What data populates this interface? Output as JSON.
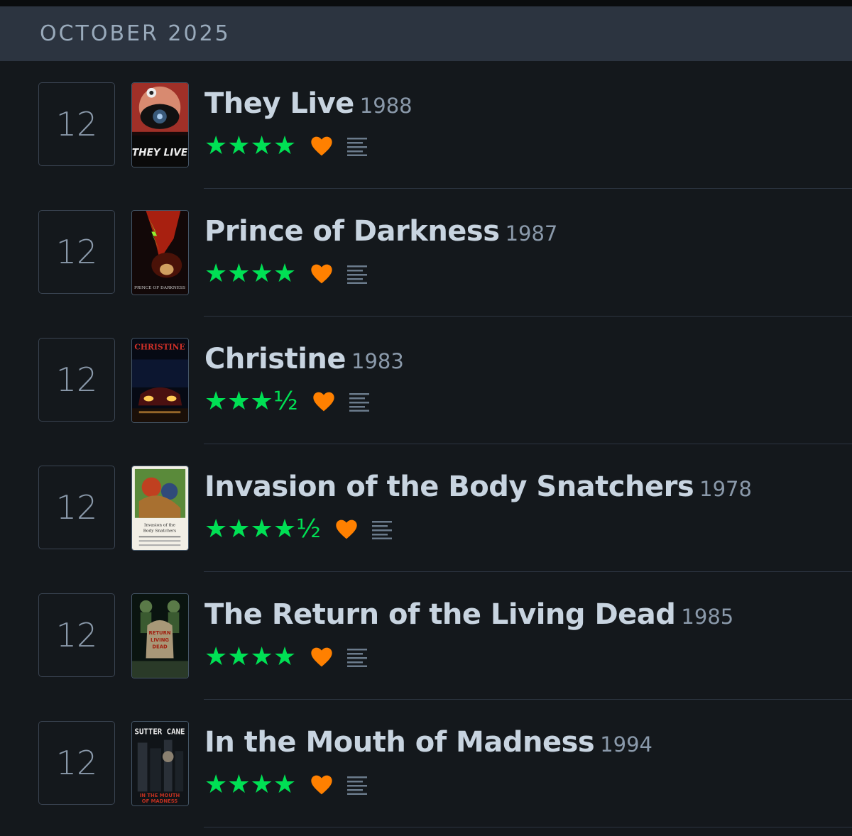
{
  "header": {
    "month": "OCTOBER 2025"
  },
  "colors": {
    "star": "#00e054",
    "heart": "#ff8000",
    "background": "#14181c",
    "header_bg": "#2c3440"
  },
  "entries": [
    {
      "day": "12",
      "title": "They Live",
      "year": "1988",
      "rating": "★★★★",
      "liked": true,
      "has_review": true,
      "poster_text": "THEY LIVE"
    },
    {
      "day": "12",
      "title": "Prince of Darkness",
      "year": "1987",
      "rating": "★★★★",
      "liked": true,
      "has_review": true,
      "poster_text": "PRINCE OF DARKNESS"
    },
    {
      "day": "12",
      "title": "Christine",
      "year": "1983",
      "rating": "★★★½",
      "liked": true,
      "has_review": true,
      "poster_text": "CHRISTINE"
    },
    {
      "day": "12",
      "title": "Invasion of the Body Snatchers",
      "year": "1978",
      "rating": "★★★★½",
      "liked": true,
      "has_review": true,
      "poster_text": "Invasion of the Body Snatchers"
    },
    {
      "day": "12",
      "title": "The Return of the Living Dead",
      "year": "1985",
      "rating": "★★★★",
      "liked": true,
      "has_review": true,
      "poster_text": "RETURN OF THE LIVING DEAD"
    },
    {
      "day": "12",
      "title": "In the Mouth of Madness",
      "year": "1994",
      "rating": "★★★★",
      "liked": true,
      "has_review": true,
      "poster_text": "SUTTER CANE"
    }
  ]
}
